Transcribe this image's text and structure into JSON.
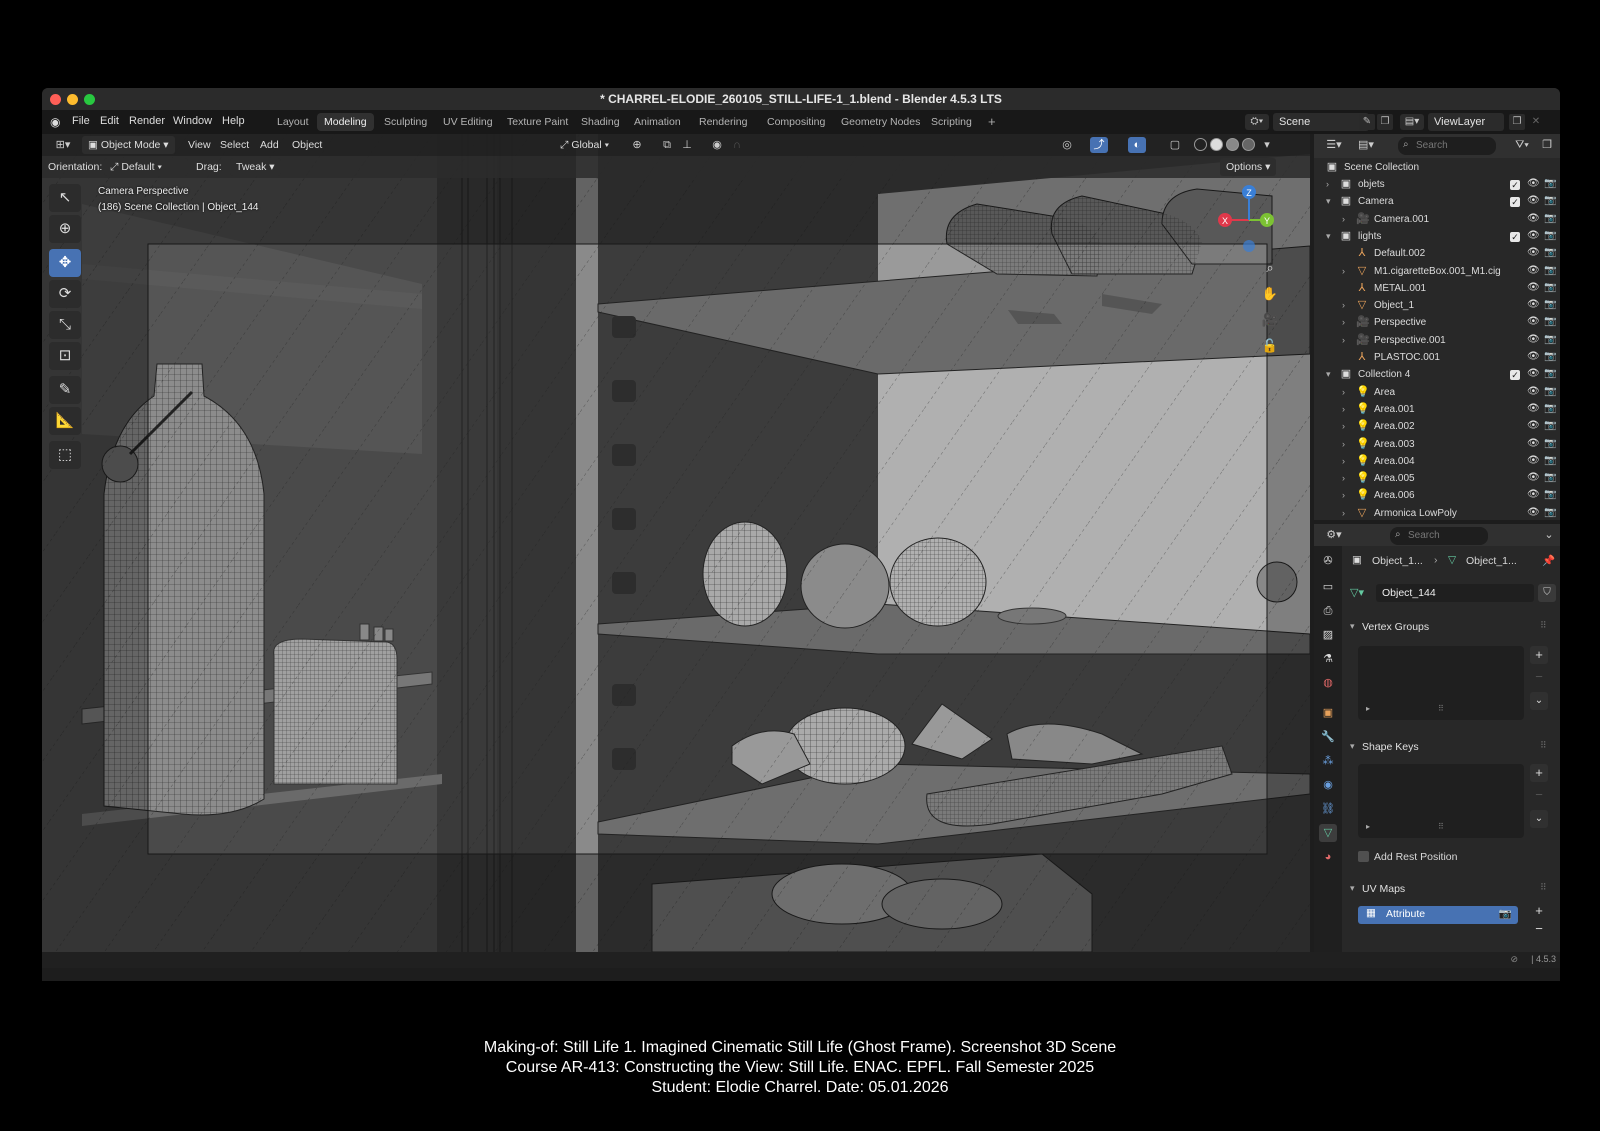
{
  "window": {
    "title": "* CHARREL-ELODIE_260105_STILL-LIFE-1_1.blend - Blender 4.5.3 LTS"
  },
  "menubar": {
    "items": [
      "File",
      "Edit",
      "Render",
      "Window",
      "Help"
    ]
  },
  "workspaces": {
    "tabs": [
      "Layout",
      "Modeling",
      "Sculpting",
      "UV Editing",
      "Texture Paint",
      "Shading",
      "Animation",
      "Rendering",
      "Compositing",
      "Geometry Nodes",
      "Scripting"
    ],
    "active": "Modeling",
    "add_label": "+"
  },
  "scene": {
    "name": "Scene",
    "view_layer": "ViewLayer"
  },
  "viewport_header": {
    "mode": "Object Mode",
    "menus": [
      "View",
      "Select",
      "Add",
      "Object"
    ],
    "transform_orientation": "Global",
    "orientation_label": "Orientation:",
    "orientation_value": "Default",
    "drag_label": "Drag:",
    "drag_value": "Tweak",
    "options_label": "Options"
  },
  "viewport_overlay": {
    "line1": "Camera Perspective",
    "line2": "(186) Scene Collection | Object_144",
    "gizmo_axes": [
      "X",
      "Y",
      "Z"
    ]
  },
  "outliner": {
    "search_placeholder": "Search",
    "root": "Scene Collection",
    "rows": [
      {
        "label": "objets",
        "indent": 1,
        "expanded": false,
        "icon": "collection-icon",
        "checkbox": true
      },
      {
        "label": "Camera",
        "indent": 1,
        "expanded": true,
        "icon": "collection-icon",
        "checkbox": true
      },
      {
        "label": "Camera.001",
        "indent": 2,
        "expanded": false,
        "icon": "camera-object-icon",
        "checkbox": false
      },
      {
        "label": "lights",
        "indent": 1,
        "expanded": true,
        "icon": "collection-icon",
        "checkbox": true
      },
      {
        "label": "Default.002",
        "indent": 2,
        "expanded": null,
        "icon": "empty-icon",
        "checkbox": false
      },
      {
        "label": "M1.cigaretteBox.001_M1.cig",
        "indent": 2,
        "expanded": false,
        "icon": "mesh-icon",
        "checkbox": false
      },
      {
        "label": "MÉTAL.001",
        "indent": 2,
        "expanded": null,
        "icon": "empty-icon",
        "checkbox": false
      },
      {
        "label": "Object_1",
        "indent": 2,
        "expanded": false,
        "icon": "mesh-icon",
        "checkbox": false
      },
      {
        "label": "Perspective",
        "indent": 2,
        "expanded": false,
        "icon": "camera-object-icon",
        "checkbox": false
      },
      {
        "label": "Perspective.001",
        "indent": 2,
        "expanded": false,
        "icon": "camera-object-icon",
        "checkbox": false
      },
      {
        "label": "PLASTOC.001",
        "indent": 2,
        "expanded": null,
        "icon": "empty-icon",
        "checkbox": false
      },
      {
        "label": "Collection 4",
        "indent": 1,
        "expanded": true,
        "icon": "collection-icon",
        "checkbox": true
      },
      {
        "label": "Area",
        "indent": 2,
        "expanded": false,
        "icon": "light-icon",
        "checkbox": false
      },
      {
        "label": "Area.001",
        "indent": 2,
        "expanded": false,
        "icon": "light-icon",
        "checkbox": false
      },
      {
        "label": "Area.002",
        "indent": 2,
        "expanded": false,
        "icon": "light-icon",
        "checkbox": false
      },
      {
        "label": "Area.003",
        "indent": 2,
        "expanded": false,
        "icon": "light-icon",
        "checkbox": false
      },
      {
        "label": "Area.004",
        "indent": 2,
        "expanded": false,
        "icon": "light-icon",
        "checkbox": false
      },
      {
        "label": "Area.005",
        "indent": 2,
        "expanded": false,
        "icon": "light-icon",
        "checkbox": false
      },
      {
        "label": "Area.006",
        "indent": 2,
        "expanded": false,
        "icon": "light-icon",
        "checkbox": false
      },
      {
        "label": "Armonica LowPoly",
        "indent": 2,
        "expanded": false,
        "icon": "mesh-icon",
        "checkbox": false
      }
    ]
  },
  "properties": {
    "search_placeholder": "Search",
    "breadcrumb_object": "Object_1...",
    "breadcrumb_data": "Object_1...",
    "data_name": "Object_144",
    "panels": {
      "vertex_groups": "Vertex Groups",
      "shape_keys": "Shape Keys",
      "add_rest_position": "Add Rest Position",
      "uv_maps": "UV Maps"
    },
    "uv_map_item": "Attribute"
  },
  "status": {
    "version": "4.5.3"
  },
  "caption": {
    "line1": "Making-of: Still Life 1. Imagined Cinematic Still Life (Ghost Frame). Screenshot 3D Scene",
    "line2": "Course AR-413: Constructing the View: Still Life. ENAC. EPFL. Fall Semester 2025",
    "line3": "Student: Elodie Charrel. Date: 05.01.2026"
  },
  "colors": {
    "accent": "#4772b3",
    "axis_x": "#e0384a",
    "axis_y": "#7cc233",
    "axis_z": "#3a7fd6",
    "light_icon": "#e8a25b",
    "data_icon": "#64c8a0"
  }
}
